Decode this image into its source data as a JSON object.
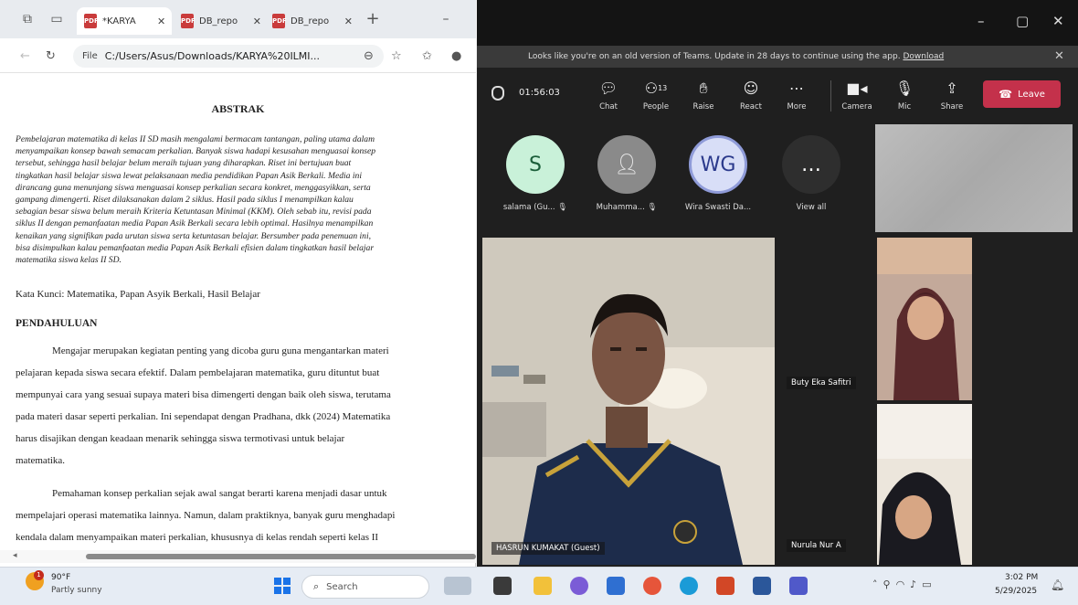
{
  "browser": {
    "tabs": [
      {
        "label": "*KARYA",
        "active": true
      },
      {
        "label": "DB_repo",
        "active": false
      },
      {
        "label": "DB_repo",
        "active": false
      }
    ],
    "address": {
      "scheme": "File",
      "url": "C:/Users/Asus/Downloads/KARYA%20ILMI..."
    },
    "document": {
      "abstract_title": "ABSTRAK",
      "abstract_lines": [
        "Pembelajaran matematika di kelas II SD masih mengalami bermacam tantangan, paling utama dalam",
        "menyampaikan konsep bawah semacam perkalian. Banyak siswa hadapi kesusahan menguasai konsep",
        "tersebut, sehingga hasil belajar belum meraih tujuan yang diharapkan. Riset ini bertujuan buat",
        "tingkatkan hasil belajar siswa lewat pelaksanaan media pendidikan Papan Asik Berkali. Media ini",
        "dirancang guna menunjang siswa menguasai konsep perkalian secara konkret, menggasyikkan, serta",
        "gampang dimengerti. Riset dilaksanakan dalam 2 siklus. Hasil pada siklus I menampilkan kalau",
        "sebagian besar siswa belum meraih Kriteria Ketuntasan Minimal (KKM). Oleh sebab itu, revisi pada",
        "siklus II dengan pemanfaatan media Papan Asik Berkali secara lebih optimal. Hasilnya menampilkan",
        "kenaikan yang signifikan pada urutan siswa serta ketuntasan belajar. Bersumber pada penemuan ini,",
        "bisa disimpulkan kalau pemanfaatan media Papan Asik Berkali efisien dalam tingkatkan hasil belajar",
        "matematika siswa kelas II SD."
      ],
      "keywords": "Kata Kunci: Matematika, Papan Asyik Berkali, Hasil Belajar",
      "intro_heading": "PENDAHULUAN",
      "para1_lines": [
        "Mengajar merupakan kegiatan penting yang dicoba guru guna mengantarkan materi",
        "pelajaran kepada siswa secara efektif. Dalam pembelajaran matematika, guru dituntut buat",
        "mempunyai cara yang sesuai supaya materi bisa dimengerti dengan baik oleh siswa, terutama",
        "pada materi dasar seperti perkalian. Ini sependapat dengan Pradhana, dkk (2024) Matematika",
        "harus disajikan dengan keadaan menarik sehingga siswa termotivasi untuk belajar",
        "matematika."
      ],
      "para2_lines": [
        "Pemahaman konsep perkalian sejak awal sangat berarti karena menjadi dasar untuk",
        "mempelajari operasi matematika lainnya. Namun, dalam praktiknya, banyak guru menghadapi",
        "kendala dalam menyampaikan materi perkalian, khususnya di kelas rendah seperti kelas II"
      ]
    }
  },
  "teams": {
    "banner": {
      "message": "Looks like you're on an old version of Teams. Update in 28 days to continue using the app.",
      "link": "Download"
    },
    "timer": "01:56:03",
    "toolbar": {
      "chat": "Chat",
      "people": "People",
      "people_count": "13",
      "raise": "Raise",
      "react": "React",
      "more": "More",
      "camera": "Camera",
      "mic": "Mic",
      "share": "Share",
      "leave": "Leave"
    },
    "participants": [
      {
        "initials": "S",
        "name": "salama (Gu..."
      },
      {
        "initials": "",
        "name": "Muhamma..."
      },
      {
        "initials": "WG",
        "name": "Wira Swasti Da..."
      },
      {
        "initials": "…",
        "name": "View all"
      }
    ],
    "main_speaker": "HASRUN KUMAKAT (Guest)",
    "tiles": [
      "Buty Eka Safitri",
      "Nurula Nur A"
    ]
  },
  "taskbar": {
    "weather": {
      "temp": "90°F",
      "desc": "Partly sunny",
      "badge": "1"
    },
    "search_placeholder": "Search",
    "time": "3:02 PM",
    "date": "5/29/2025",
    "colors": {
      "accent": "#1a73e8",
      "leave": "#c4314b"
    }
  }
}
